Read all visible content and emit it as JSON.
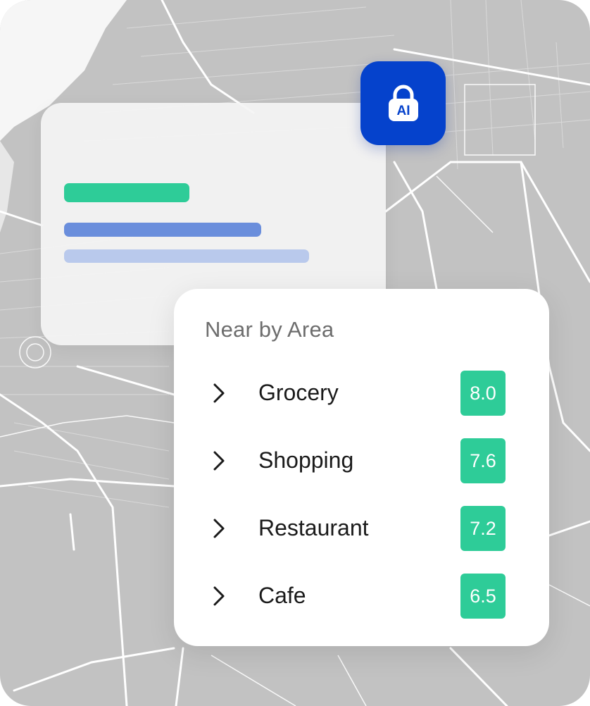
{
  "colors": {
    "map_background": "#c2c2c2",
    "map_roads": "#ffffff",
    "accent_green": "#2ecc98",
    "accent_blue": "#0542cc",
    "skeleton_blue": "#6a8edc",
    "skeleton_blue_light": "#b9c9ec"
  },
  "ai_button": {
    "label": "AI",
    "icon": "lock-icon"
  },
  "nearby": {
    "title": "Near by Area",
    "items": [
      {
        "label": "Grocery",
        "score": "8.0",
        "icon": "chevron-right-icon"
      },
      {
        "label": "Shopping",
        "score": "7.6",
        "icon": "chevron-right-icon"
      },
      {
        "label": "Restaurant",
        "score": "7.2",
        "icon": "chevron-right-icon"
      },
      {
        "label": "Cafe",
        "score": "6.5",
        "icon": "chevron-right-icon"
      }
    ]
  }
}
